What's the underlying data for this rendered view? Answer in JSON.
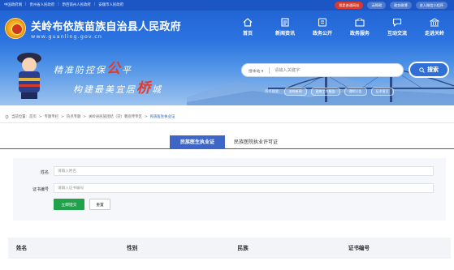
{
  "topbar": {
    "links": [
      "中国政府网",
      "贵州省人民政府",
      "黔西南州人民政府",
      "安顺市人民政府"
    ],
    "pills": [
      "我是普通网站",
      "无障碍",
      "政务微博",
      "进入微信小程序"
    ]
  },
  "header": {
    "title": "关岭布依族苗族自治县人民政府",
    "url": "www.guanling.gov.cn"
  },
  "nav": {
    "items": [
      {
        "label": "首页",
        "icon": "home-icon"
      },
      {
        "label": "新闻资讯",
        "icon": "news-icon"
      },
      {
        "label": "政务公开",
        "icon": "document-icon"
      },
      {
        "label": "政务服务",
        "icon": "service-icon"
      },
      {
        "label": "互动交流",
        "icon": "chat-icon"
      },
      {
        "label": "走进关岭",
        "icon": "landmark-icon"
      }
    ]
  },
  "banner": {
    "slogan1_a": "精准防控保",
    "slogan1_b": "公",
    "slogan1_c": "平",
    "slogan2_a": "构建最美宜居",
    "slogan2_b": "桥",
    "slogan2_c": "城"
  },
  "search": {
    "scope": "搜本站 ▾",
    "placeholder": "请输入关键字",
    "button_label": "搜索"
  },
  "hot": {
    "label": "热点搜索:",
    "tags": [
      "关岭新闻",
      "政府工作报告",
      "通知公告",
      "征求意见"
    ]
  },
  "breadcrumb": {
    "prefix": "当前位置:",
    "items": [
      "首页",
      "专题专栏",
      "热点专题",
      "关岭县民族团结（宗）教宣传专区"
    ],
    "current": "民族医生执业证"
  },
  "tabs": {
    "active": "民族医生执业证",
    "inactive": "民族医院执业许可证"
  },
  "form": {
    "name_label": "姓名",
    "name_placeholder": "请输入姓名",
    "cert_label": "证书编号",
    "cert_placeholder": "请输入证书编号",
    "submit_label": "立即提交",
    "reset_label": "重置"
  },
  "table": {
    "headers": [
      "姓名",
      "性别",
      "民族",
      "证书编号"
    ]
  },
  "colors": {
    "header_blue": "#1f5fd0",
    "tab_active": "#3d66c6",
    "submit_green": "#1fa24a",
    "accent_red": "#d83a2e"
  }
}
